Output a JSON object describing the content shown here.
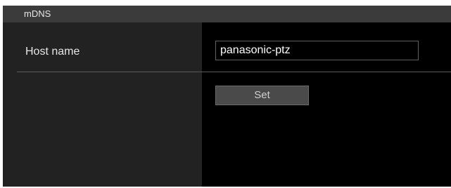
{
  "section": {
    "title": "mDNS"
  },
  "host": {
    "label": "Host name",
    "value": "panasonic-ptz"
  },
  "actions": {
    "set_label": "Set"
  }
}
